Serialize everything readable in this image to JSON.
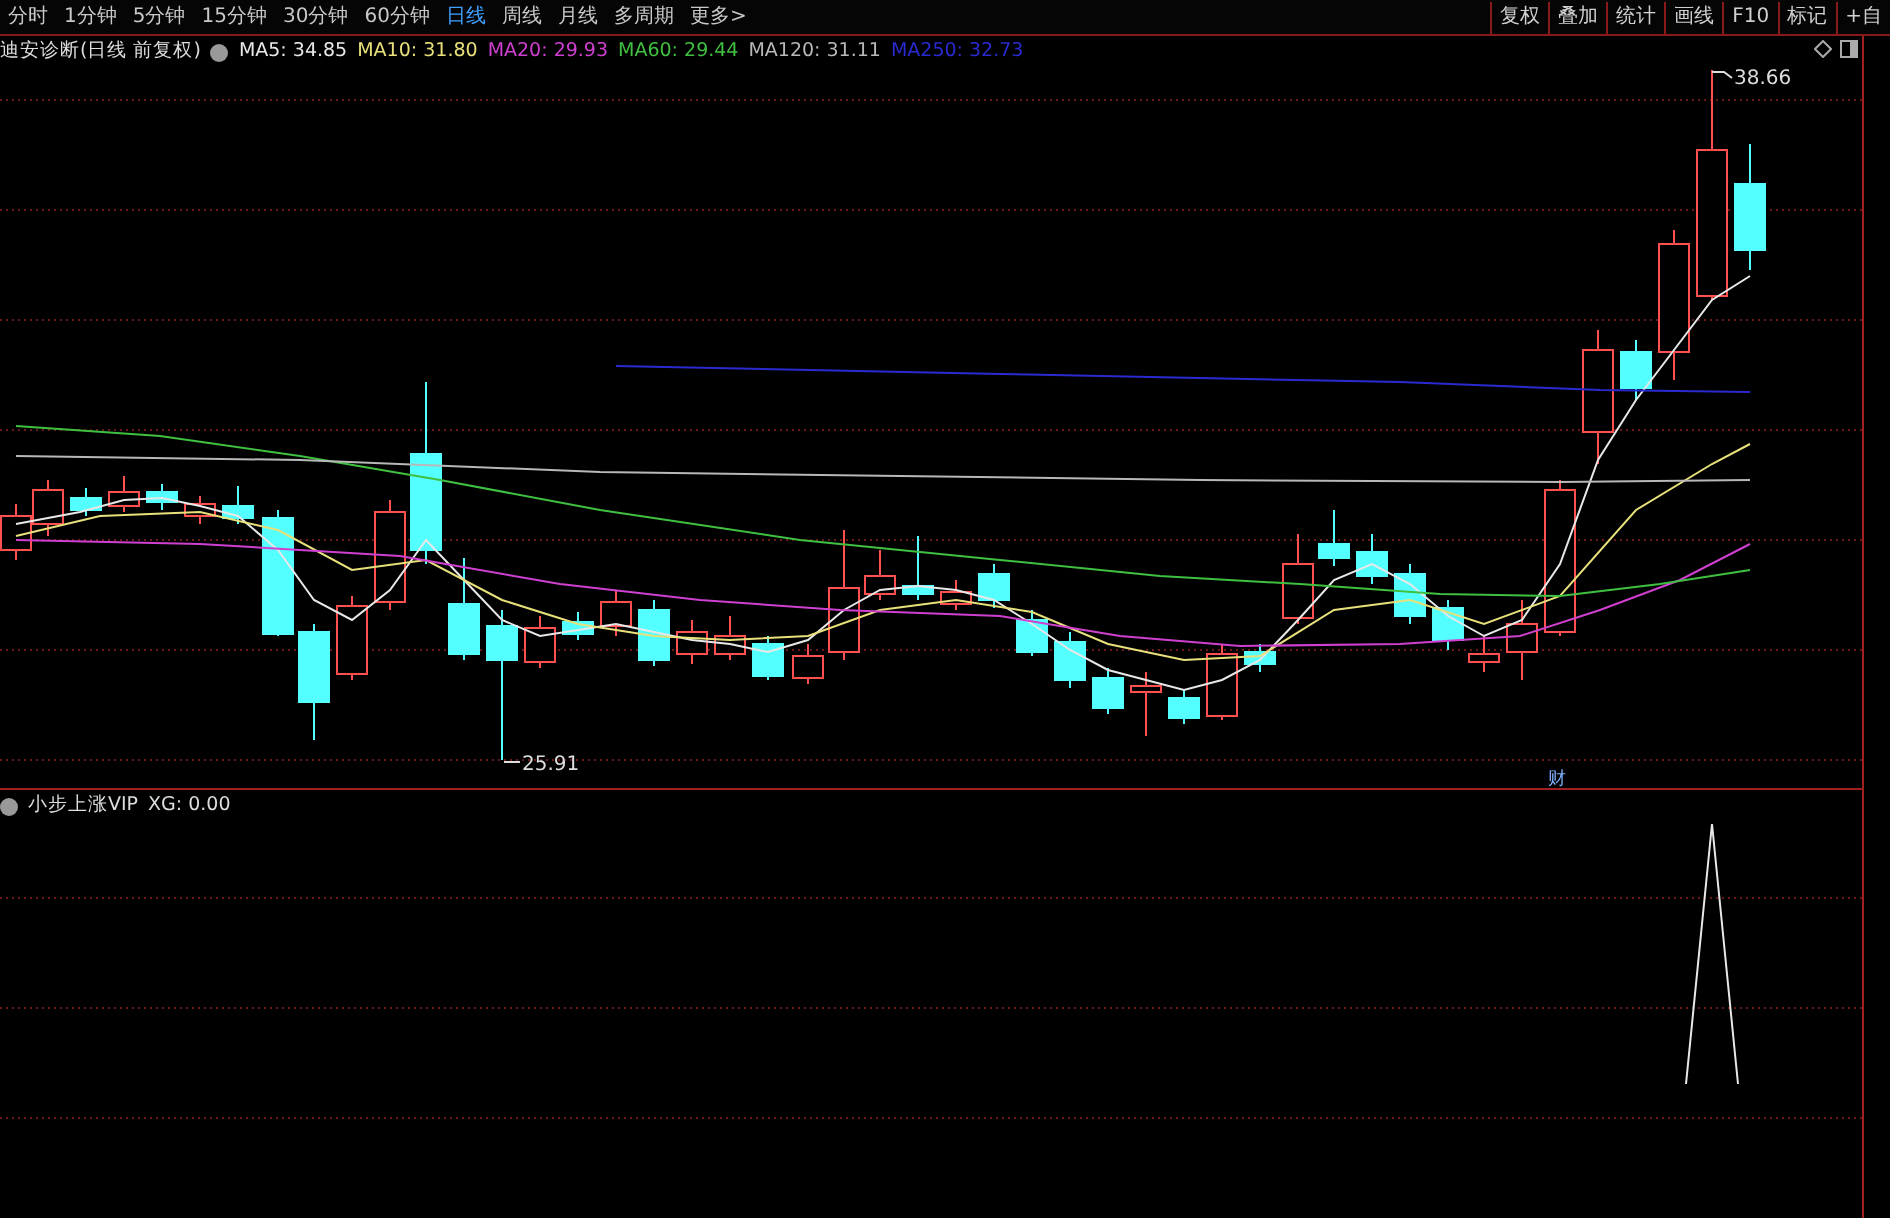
{
  "period_tabs": [
    {
      "label": "分时",
      "selected": false
    },
    {
      "label": "1分钟",
      "selected": false
    },
    {
      "label": "5分钟",
      "selected": false
    },
    {
      "label": "15分钟",
      "selected": false
    },
    {
      "label": "30分钟",
      "selected": false
    },
    {
      "label": "60分钟",
      "selected": false
    },
    {
      "label": "日线",
      "selected": true
    },
    {
      "label": "周线",
      "selected": false
    },
    {
      "label": "月线",
      "selected": false
    },
    {
      "label": "多周期",
      "selected": false
    },
    {
      "label": "更多>",
      "selected": false
    }
  ],
  "tool_buttons": [
    "复权",
    "叠加",
    "统计",
    "画线",
    "F10",
    "标记",
    "+自"
  ],
  "main_chart": {
    "title": "迪安诊断(日线 前复权)",
    "moving_averages": [
      {
        "label": "MA5: 34.85",
        "color": "#e8e8e8"
      },
      {
        "label": "MA10: 31.80",
        "color": "#e8e07a"
      },
      {
        "label": "MA20: 29.93",
        "color": "#d040d0"
      },
      {
        "label": "MA60: 29.44",
        "color": "#40c040"
      },
      {
        "label": "MA120: 31.11",
        "color": "#b8b8b8"
      },
      {
        "label": "MA250: 32.73",
        "color": "#2a2ad0"
      }
    ],
    "high_label": "38.66",
    "low_label": "25.91",
    "event_marker": "财"
  },
  "indicator": {
    "name": "小步上涨VIP",
    "reading": "XG: 0.00"
  }
}
